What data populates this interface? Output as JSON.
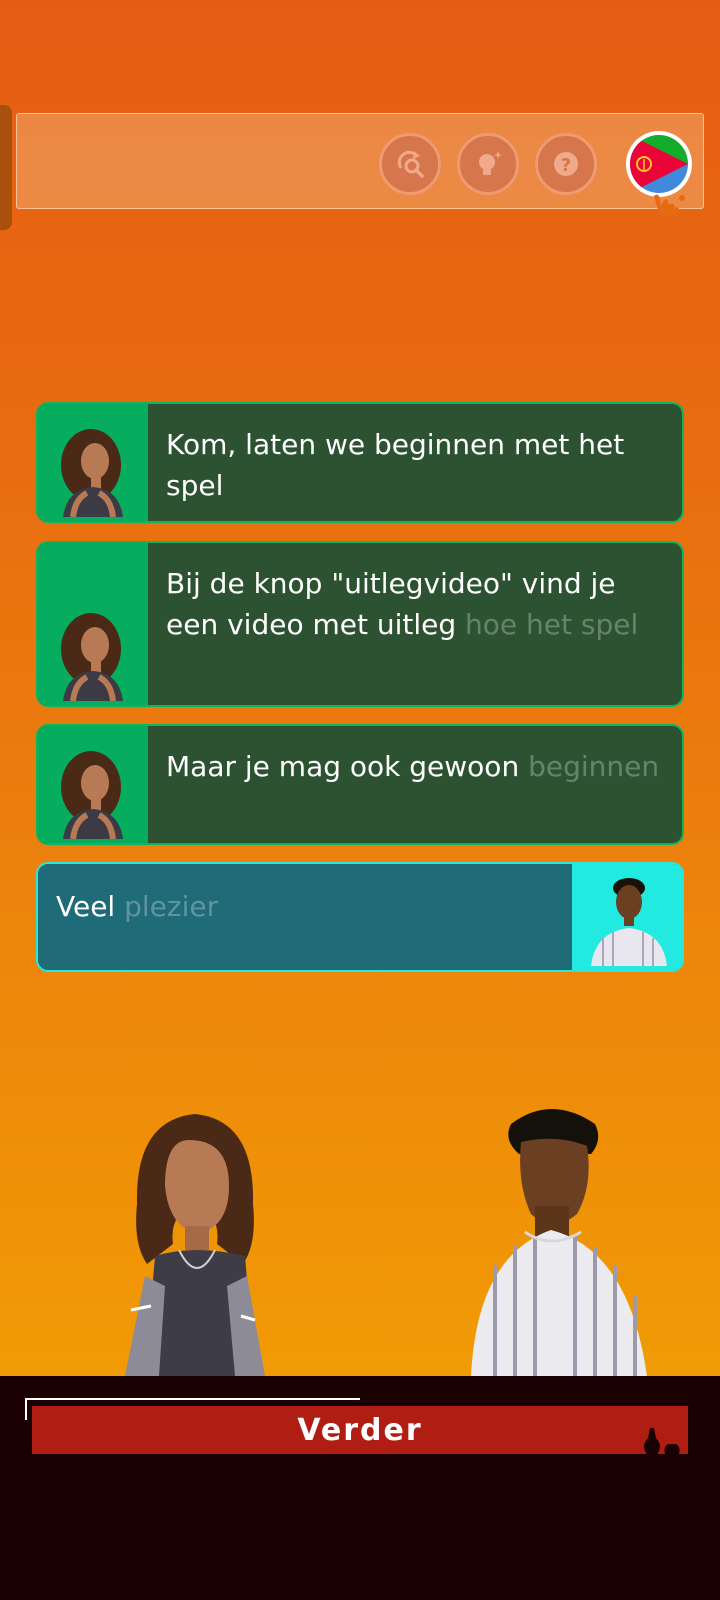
{
  "toolbar": {
    "icons": [
      "search-refresh-icon",
      "lightbulb-icon",
      "question-icon",
      "eritrea-flag-icon"
    ],
    "accent": "#d6764c"
  },
  "messages": [
    {
      "speaker": "woman",
      "side": "left",
      "text": "Kom, laten we beginnen met het spel",
      "fade_text": ""
    },
    {
      "speaker": "woman",
      "side": "left",
      "text": "Bij de knop \"uitlegvideo\" vind je een video met uitleg ",
      "fade_text": "hoe het spel"
    },
    {
      "speaker": "woman",
      "side": "left",
      "text": "Maar je mag ook gewoon ",
      "fade_text": "beginnen"
    },
    {
      "speaker": "man",
      "side": "right",
      "text": "Veel ",
      "fade_text": "plezier"
    }
  ],
  "footer": {
    "button_label": "Verder"
  },
  "colors": {
    "left_bubble": "#2c5232",
    "left_avatar_bg": "#06ad5e",
    "right_bubble": "#1f6b78",
    "right_avatar_bg": "#22eae0",
    "button": "#b01e13"
  }
}
